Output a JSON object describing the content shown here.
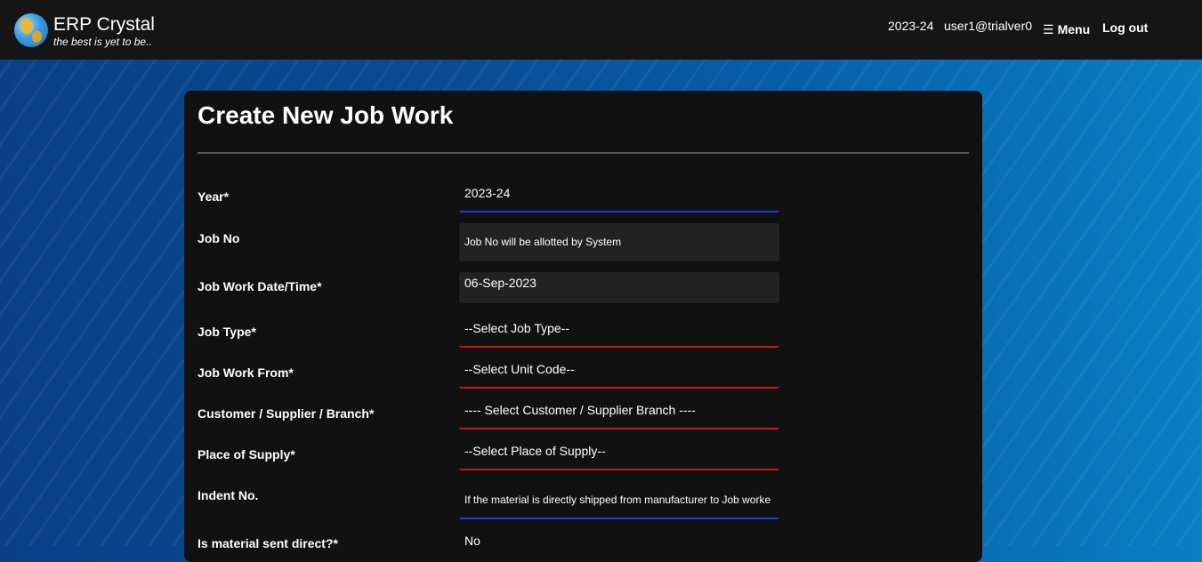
{
  "header": {
    "app_name": "ERP Crystal",
    "tagline": "the best is yet to be..",
    "year": "2023-24",
    "user": "user1@trialver0",
    "menu_label": "Menu",
    "logout_label": "Log out"
  },
  "form": {
    "title": "Create New Job Work",
    "year": {
      "label": "Year*",
      "value": "2023-24"
    },
    "job_no": {
      "label": "Job No",
      "value": "Job No will be allotted by System"
    },
    "job_work_date": {
      "label": "Job Work Date/Time*",
      "value": "06-Sep-2023"
    },
    "job_type": {
      "label": "Job Type*",
      "value": "--Select Job Type--"
    },
    "job_work_from": {
      "label": "Job Work From*",
      "value": "--Select Unit Code--"
    },
    "customer": {
      "label": "Customer / Supplier / Branch*",
      "value": "---- Select Customer / Supplier Branch ----"
    },
    "place_of_supply": {
      "label": "Place of Supply*",
      "value": "--Select Place of Supply--"
    },
    "indent_no": {
      "label": "Indent No.",
      "placeholder": "If the material is directly shipped from manufacturer to Job worke"
    },
    "material_direct": {
      "label": "Is material sent direct?*",
      "value": "No"
    }
  },
  "colors": {
    "valid_underline": "#1a3ed8",
    "required_underline": "#c41a1a",
    "topbar_bg": "#151515",
    "card_bg": "#111111"
  }
}
